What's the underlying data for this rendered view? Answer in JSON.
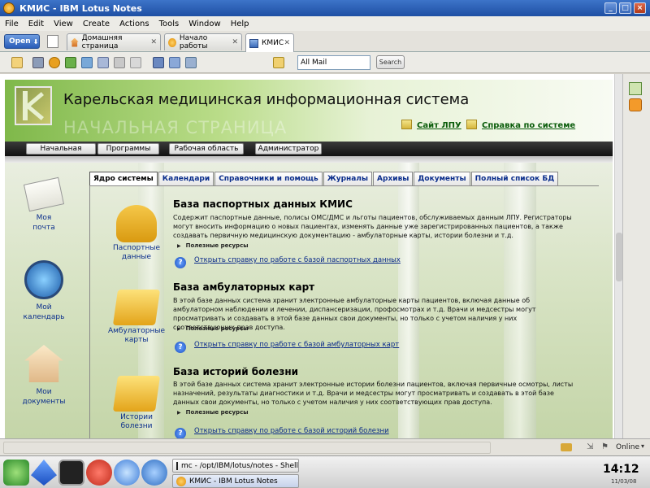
{
  "window": {
    "title": "КМИС - IBM Lotus Notes"
  },
  "menu": [
    "File",
    "Edit",
    "View",
    "Create",
    "Actions",
    "Tools",
    "Window",
    "Help"
  ],
  "tabs": {
    "open_label": "Open",
    "items": [
      {
        "label": "Домашняя страница",
        "icon": "home-icon"
      },
      {
        "label": "Начало работы",
        "icon": "lotus-icon"
      },
      {
        "label": "КМИС",
        "icon": "db-icon",
        "active": true
      }
    ]
  },
  "toolbar": {
    "search_value": "All Mail",
    "search_button": "Search"
  },
  "header": {
    "title": "Карельская медицинская информационная система",
    "watermark": "НАЧАЛЬНАЯ СТРАНИЦА",
    "link1": "Сайт ЛПУ",
    "link2": "Справка по системе"
  },
  "nav": [
    "Начальная",
    "Программы",
    "Рабочая область",
    "Администратор"
  ],
  "sidebar": [
    {
      "label1": "Моя",
      "label2": "почта",
      "icon": "mail-icon"
    },
    {
      "label1": "Мой",
      "label2": "календарь",
      "icon": "clock-icon"
    },
    {
      "label1": "Мои",
      "label2": "документы",
      "icon": "house-icon"
    }
  ],
  "core_tabs": [
    "Ядро системы",
    "Календари",
    "Справочники и помощь",
    "Журналы",
    "Архивы",
    "Документы",
    "Полный список БД"
  ],
  "sections": [
    {
      "icon_label1": "Паспортные",
      "icon_label2": "данные",
      "title": "База паспортных данных КМИС",
      "desc": "Содержит паспортные данные, полисы ОМС/ДМС и льготы пациентов, обслуживаемых данным ЛПУ. Регистраторы могут вносить информацию о новых пациентах, изменять данные уже зарегистрированных пациентов, а также создавать первичную медицинскую документацию - амбулаторные карты, истории болезни и т.д.",
      "resources": "Полезные ресурсы",
      "help": "Открыть справку по работе с базой паспортных данных"
    },
    {
      "icon_label1": "Амбулаторные",
      "icon_label2": "карты",
      "title": "База амбулаторных карт",
      "desc": "В этой базе данных система хранит электронные амбулаторные карты пациентов, включая данные об амбулаторном наблюдении и лечении, диспансеризации, профосмотрах и т.д. Врачи и медсестры могут просматривать и создавать в этой базе данных свои документы, но только с учетом наличия у них соответствующих прав доступа.",
      "resources": "Полезные ресурсы",
      "help": "Открыть справку по работе с базой амбулаторных карт"
    },
    {
      "icon_label1": "Истории",
      "icon_label2": "болезни",
      "title": "База историй болезни",
      "desc": "В этой базе данных система хранит электронные истории болезни пациентов, включая первичные осмотры, листы назначений, результаты диагностики и т.д. Врачи и медсестры могут просматривать и создавать в этой базе данных свои документы, но только с учетом наличия у них соответствующих прав доступа.",
      "resources": "Полезные ресурсы",
      "help": "Открыть справку по работе с базой историй болезни"
    }
  ],
  "status": {
    "online": "Online"
  },
  "taskbar": {
    "win1": "mc - /opt/IBM/lotus/notes - Shell",
    "win2": "КМИС - IBM Lotus Notes",
    "time": "14:12",
    "date": "11/03/08"
  }
}
